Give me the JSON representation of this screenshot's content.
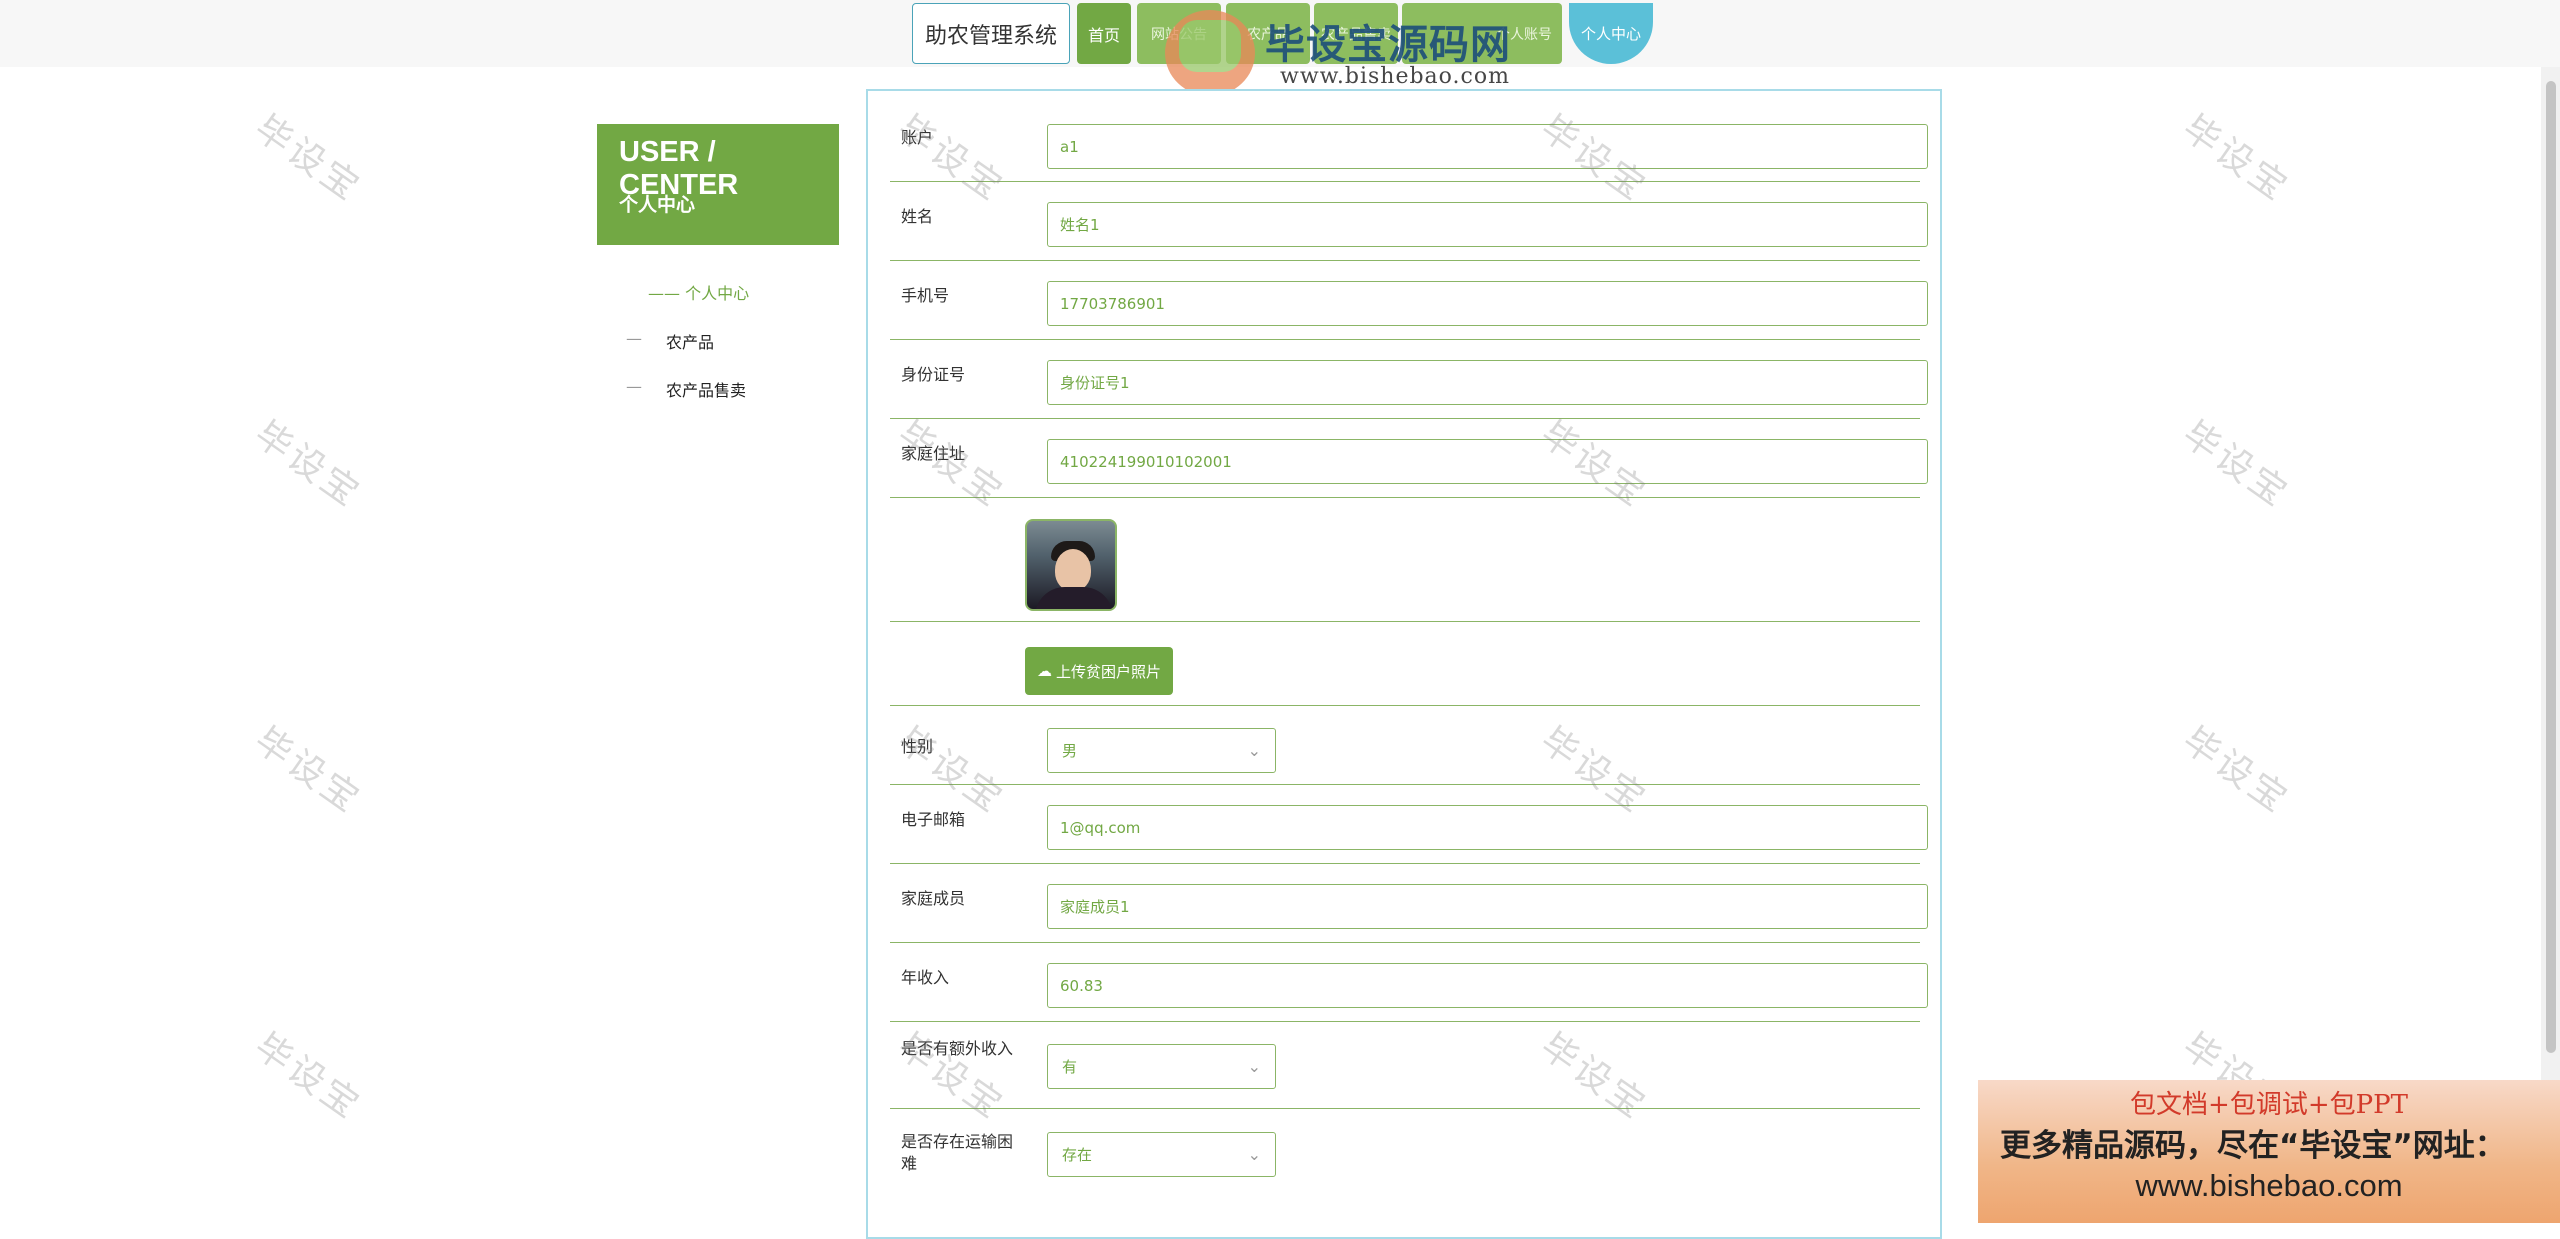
{
  "header": {
    "brand": "助农管理系统",
    "nav": [
      {
        "label": "首页"
      },
      {
        "label": "网站公告"
      },
      {
        "label": "农产品"
      },
      {
        "label": "农产品售卖"
      },
      {
        "label": "个人账号"
      }
    ],
    "user_center": "个人中心"
  },
  "logo_watermark": {
    "name": "毕设宝源码网",
    "url": "www.bishebao.com"
  },
  "sidebar": {
    "title_en": "USER / CENTER",
    "title_cn": "个人中心",
    "items": [
      {
        "label": "—— 个人中心"
      },
      {
        "label": "农产品"
      },
      {
        "label": "农产品售卖"
      }
    ],
    "dash": "—"
  },
  "form": {
    "fields": [
      {
        "label": "账户",
        "value": "a1"
      },
      {
        "label": "姓名",
        "value": "姓名1"
      },
      {
        "label": "手机号",
        "value": "17703786901"
      },
      {
        "label": "身份证号",
        "value": "身份证号1"
      },
      {
        "label": "家庭住址",
        "value": "410224199010102001"
      }
    ],
    "upload_label": "上传贫困户照片",
    "gender": {
      "label": "性别",
      "value": "男"
    },
    "email": {
      "label": "电子邮箱",
      "value": "1@qq.com"
    },
    "family": {
      "label": "家庭成员",
      "value": "家庭成员1"
    },
    "income": {
      "label": "年收入",
      "value": "60.83"
    },
    "extra_income": {
      "label": "是否有额外收入",
      "value": "有"
    },
    "transport": {
      "label": "是否存在运输困难",
      "value": "存在"
    }
  },
  "watermark_text": "毕设宝",
  "promo": {
    "line1": "包文档+包调试+包PPT",
    "line2": "更多精品源码，尽在“毕设宝”网址：",
    "line3": "www.bishebao.com"
  }
}
